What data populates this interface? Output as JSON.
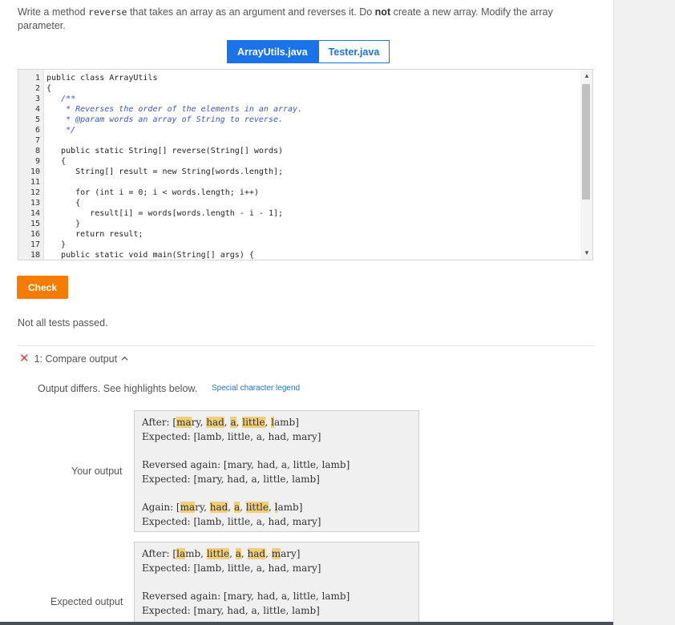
{
  "prompt": {
    "p1": "Write a method ",
    "code1": "reverse",
    "p2": " that takes an array as an argument and reverses it. Do ",
    "bold": "not",
    "p3": " create a new array. Modify the array parameter."
  },
  "tabs": [
    {
      "label": "ArrayUtils.java",
      "active": true
    },
    {
      "label": "Tester.java",
      "active": false
    }
  ],
  "code_lines": [
    {
      "n": "1",
      "text": "public class ArrayUtils",
      "comment": false
    },
    {
      "n": "2",
      "text": "{",
      "comment": false
    },
    {
      "n": "3",
      "text": "   /**",
      "comment": true
    },
    {
      "n": "4",
      "text": "    * Reverses the order of the elements in an array.",
      "comment": true
    },
    {
      "n": "5",
      "text": "    * @param words an array of String to reverse.",
      "comment": true
    },
    {
      "n": "6",
      "text": "    */",
      "comment": true
    },
    {
      "n": "7",
      "text": "",
      "comment": false
    },
    {
      "n": "8",
      "text": "   public static String[] reverse(String[] words)",
      "comment": false
    },
    {
      "n": "9",
      "text": "   {",
      "comment": false
    },
    {
      "n": "10",
      "text": "      String[] result = new String[words.length];",
      "comment": false
    },
    {
      "n": "11",
      "text": "",
      "comment": false
    },
    {
      "n": "12",
      "text": "      for (int i = 0; i < words.length; i++)",
      "comment": false
    },
    {
      "n": "13",
      "text": "      {",
      "comment": false
    },
    {
      "n": "14",
      "text": "         result[i] = words[words.length - i - 1];",
      "comment": false
    },
    {
      "n": "15",
      "text": "      }",
      "comment": false
    },
    {
      "n": "16",
      "text": "      return result;",
      "comment": false
    },
    {
      "n": "17",
      "text": "   }",
      "comment": false
    },
    {
      "n": "18",
      "text": "   public static void main(String[] args) {",
      "comment": false
    }
  ],
  "check_label": "Check",
  "status_text": "Not all tests passed.",
  "test": {
    "title": "1: Compare output",
    "differs": "Output differs. See highlights below.",
    "legend_link": "Special character legend",
    "your_output_label": "Your output",
    "expected_output_label": "Expected output",
    "your_output": [
      [
        [
          "After: [",
          false
        ],
        [
          "ma",
          true
        ],
        [
          "ry",
          false
        ],
        [
          ", ",
          false
        ],
        [
          "had",
          true
        ],
        [
          ", ",
          false
        ],
        [
          "a",
          true
        ],
        [
          ", ",
          false
        ],
        [
          "little",
          true
        ],
        [
          ", ",
          false
        ],
        [
          "l",
          true
        ],
        [
          "amb",
          false
        ],
        [
          "]",
          false
        ]
      ],
      [
        [
          "Expected: [lamb, little, a, had, mary]",
          false
        ]
      ],
      null,
      [
        [
          "Reversed again: [mary, had, a, little, lamb]",
          false
        ]
      ],
      [
        [
          "Expected: [mary, had, a, little, lamb]",
          false
        ]
      ],
      null,
      [
        [
          "Again: [",
          false
        ],
        [
          "ma",
          true
        ],
        [
          "ry",
          false
        ],
        [
          ", ",
          false
        ],
        [
          "had",
          true
        ],
        [
          ", ",
          false
        ],
        [
          "a",
          true
        ],
        [
          ", ",
          false
        ],
        [
          "little",
          true
        ],
        [
          ", ",
          false
        ],
        [
          "l",
          true
        ],
        [
          "amb",
          false
        ],
        [
          "]",
          false
        ]
      ],
      [
        [
          "Expected: [lamb, little, a, had, mary]",
          false
        ]
      ]
    ],
    "expected_output": [
      [
        [
          "After: [",
          false
        ],
        [
          "la",
          true
        ],
        [
          "mb",
          false
        ],
        [
          ", ",
          false
        ],
        [
          "little",
          true
        ],
        [
          ", ",
          false
        ],
        [
          "a",
          true
        ],
        [
          ", ",
          false
        ],
        [
          "had",
          true
        ],
        [
          ", ",
          false
        ],
        [
          "m",
          true
        ],
        [
          "ary",
          false
        ],
        [
          "]",
          false
        ]
      ],
      [
        [
          "Expected: [lamb, little, a, had, mary]",
          false
        ]
      ],
      null,
      [
        [
          "Reversed again: [mary, had, a, little, lamb]",
          false
        ]
      ],
      [
        [
          "Expected: [mary, had, a, little, lamb]",
          false
        ]
      ]
    ]
  },
  "colors": {
    "accent": "#1a73e8",
    "check": "#f57c00",
    "error": "#e53935",
    "highlight": "#f1cf7a"
  }
}
